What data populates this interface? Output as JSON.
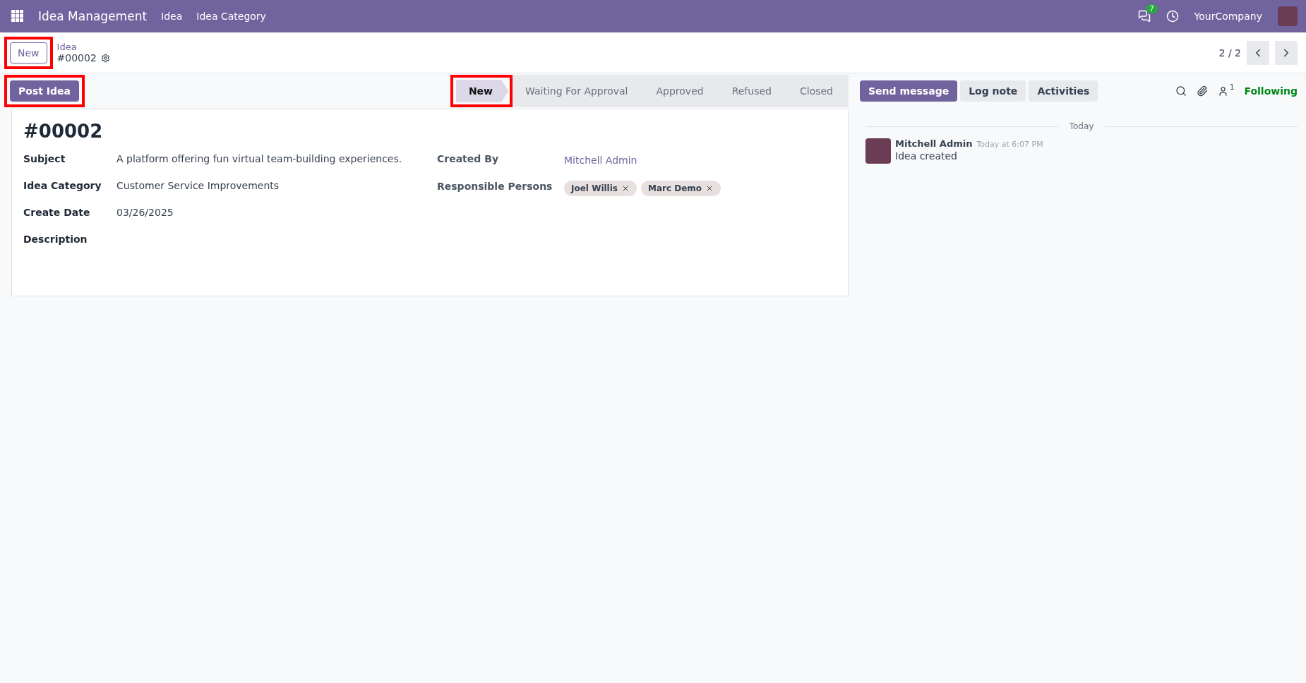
{
  "navbar": {
    "app_title": "Idea Management",
    "menu": [
      "Idea",
      "Idea Category"
    ],
    "messages_badge": "7",
    "company": "YourCompany"
  },
  "control_panel": {
    "new_button": {
      "label": "New",
      "highlighted": true
    },
    "breadcrumb": "Idea",
    "record": "#00002",
    "pager": "2 / 2"
  },
  "actions": [
    {
      "label": "Post Idea",
      "highlighted": true
    }
  ],
  "stages": [
    {
      "label": "New",
      "selected": true,
      "highlighted": true
    },
    {
      "label": "Waiting For Approval",
      "selected": false,
      "highlighted": false
    },
    {
      "label": "Approved",
      "selected": false,
      "highlighted": false
    },
    {
      "label": "Refused",
      "selected": false,
      "highlighted": false
    },
    {
      "label": "Closed",
      "selected": false,
      "highlighted": false
    }
  ],
  "form": {
    "title": "#00002",
    "left_fields": [
      {
        "label": "Subject",
        "kind": "text",
        "value": "A platform offering fun virtual team-building experiences."
      },
      {
        "label": "Idea Category",
        "kind": "text",
        "value": "Customer Service Improvements"
      },
      {
        "label": "Create Date",
        "kind": "text",
        "value": "03/26/2025"
      },
      {
        "label": "Description",
        "kind": "text"
      }
    ],
    "right_fields": [
      {
        "label": "Created By",
        "kind": "link",
        "value": "Mitchell Admin"
      },
      {
        "label": "Responsible Persons",
        "kind": "tags",
        "tags": [
          "Joel Willis",
          "Marc Demo"
        ]
      }
    ]
  },
  "chatter": {
    "buttons": [
      {
        "label": "Send message",
        "kind": "primary"
      },
      {
        "label": "Log note",
        "kind": "secondary"
      },
      {
        "label": "Activities",
        "kind": "secondary"
      }
    ],
    "followers_count": "1",
    "follow_status": "Following",
    "date_separator": "Today",
    "messages": [
      {
        "author": "Mitchell Admin",
        "time": "Today at 6:07 PM",
        "body": "Idea created"
      }
    ]
  }
}
